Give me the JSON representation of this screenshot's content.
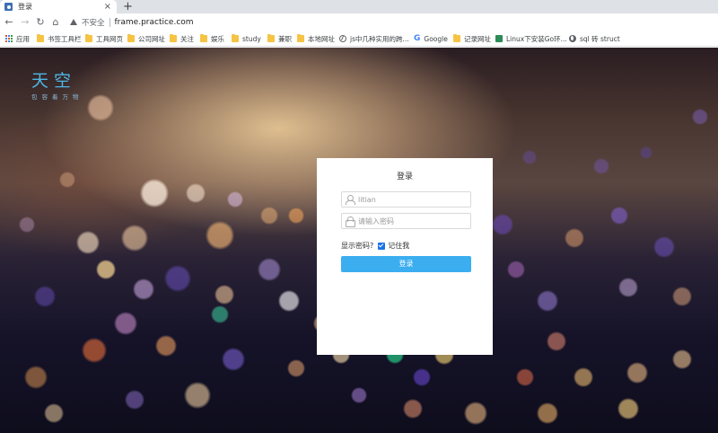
{
  "browser": {
    "tab_title": "登录",
    "tab_close": "×",
    "new_tab": "+",
    "nav": {
      "back": "←",
      "forward": "→",
      "reload": "↻",
      "home": "⌂"
    },
    "insecure_label": "不安全",
    "url": "frame.practice.com"
  },
  "bookmarks": [
    {
      "label": "应用",
      "icon": "apps-icon"
    },
    {
      "label": "书签工具栏",
      "icon": "folder-icon"
    },
    {
      "label": "工具网页",
      "icon": "folder-icon"
    },
    {
      "label": "公司网址",
      "icon": "folder-icon"
    },
    {
      "label": "关注",
      "icon": "folder-icon"
    },
    {
      "label": "娱乐",
      "icon": "folder-icon"
    },
    {
      "label": "study",
      "icon": "folder-icon"
    },
    {
      "label": "兼职",
      "icon": "folder-icon"
    },
    {
      "label": "本地网址",
      "icon": "folder-icon"
    },
    {
      "label": "js中几种实用的跨...",
      "icon": "js-icon"
    },
    {
      "label": "Google",
      "icon": "google-icon"
    },
    {
      "label": "记录网址",
      "icon": "folder-icon"
    },
    {
      "label": "Linux下安装Go环...",
      "icon": "linux-icon"
    },
    {
      "label": "sql 砖 struct",
      "icon": "globe-icon"
    }
  ],
  "logo": {
    "title": "天空",
    "subtitle": "包容着万物"
  },
  "login": {
    "title": "登录",
    "username_value": "litian",
    "password_placeholder": "请输入密码",
    "show_password_label": "显示密码?",
    "remember_label": "记住我",
    "submit_label": "登录"
  }
}
